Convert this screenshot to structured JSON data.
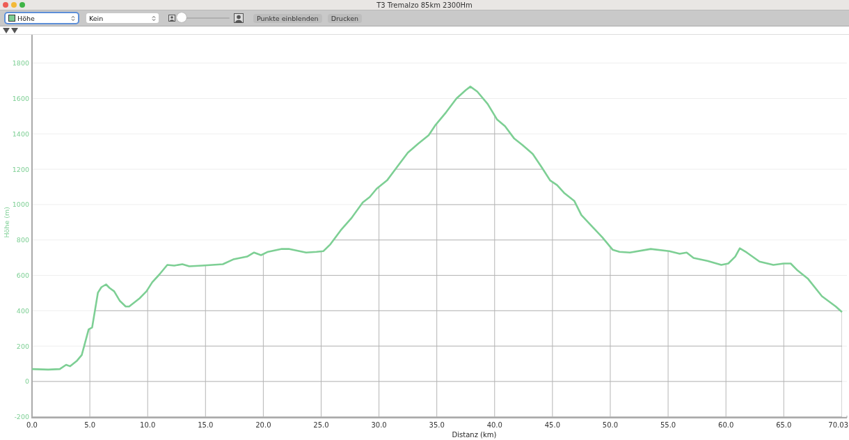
{
  "window": {
    "title": "T3 Tremalzo 85km 2300Hm"
  },
  "toolbar": {
    "series_select": {
      "focused": true
    },
    "secondary_select": {
      "value": "Kein"
    },
    "zoom_slider": {
      "level": 0
    },
    "buttons": [
      "Punkte einblenden",
      "Drucken"
    ]
  },
  "chart": {
    "chart_data": {
      "type": "line",
      "grid": true,
      "xlabel": "Distanz (km)",
      "ylabel": "Höhe (m)",
      "x": [
        0,
        1.4,
        2.4,
        2.95,
        3.3,
        3.9,
        4.3,
        4.9,
        5.2,
        5.7,
        6.0,
        6.4,
        6.7,
        7.1,
        7.6,
        8.1,
        8.4,
        9.3,
        9.9,
        10.4,
        11.0,
        11.7,
        12.3,
        13.0,
        13.6,
        14.7,
        16.5,
        17.4,
        18.6,
        19.2,
        19.8,
        20.4,
        21.6,
        22.2,
        23.7,
        24.6,
        25.2,
        25.8,
        26.7,
        27.6,
        28.6,
        29.2,
        29.8,
        30.7,
        31.6,
        32.5,
        33.4,
        34.3,
        34.9,
        35.8,
        36.7,
        37.5,
        37.9,
        38.5,
        39.4,
        40.2,
        40.9,
        41.7,
        42.4,
        43.3,
        44.1,
        44.8,
        45.4,
        46.0,
        46.9,
        47.5,
        48.4,
        49.3,
        50.2,
        50.8,
        51.7,
        53.5,
        55.1,
        56.0,
        56.6,
        57.2,
        58.4,
        59.6,
        60.2,
        60.8,
        61.2,
        61.8,
        62.9,
        64.1,
        65.0,
        65.6,
        66.2,
        67.1,
        68.3,
        69.5,
        70.03
      ],
      "series": [
        {
          "name": "Höhe",
          "color": "#7dcf94",
          "values": [
            70,
            67,
            70,
            94,
            86,
            118,
            150,
            294,
            305,
            502,
            533,
            549,
            529,
            510,
            455,
            424,
            424,
            470,
            510,
            561,
            604,
            659,
            655,
            663,
            651,
            655,
            663,
            690,
            706,
            729,
            714,
            733,
            749,
            749,
            729,
            733,
            737,
            776,
            855,
            922,
            1012,
            1043,
            1090,
            1137,
            1216,
            1294,
            1345,
            1392,
            1451,
            1522,
            1600,
            1647,
            1667,
            1639,
            1569,
            1482,
            1443,
            1373,
            1337,
            1286,
            1208,
            1137,
            1110,
            1067,
            1020,
            941,
            878,
            816,
            745,
            733,
            729,
            749,
            737,
            722,
            729,
            698,
            682,
            659,
            667,
            706,
            753,
            729,
            678,
            659,
            667,
            667,
            627,
            580,
            482,
            424,
            392
          ]
        }
      ],
      "xlim": [
        0,
        70.46
      ],
      "ylim": [
        -205,
        1960
      ],
      "xticks": [
        {
          "value": 0,
          "label": "0.0"
        },
        {
          "value": 5,
          "label": "5.0"
        },
        {
          "value": 10,
          "label": "10.0"
        },
        {
          "value": 15,
          "label": "15.0"
        },
        {
          "value": 20,
          "label": "20.0"
        },
        {
          "value": 25,
          "label": "25.0"
        },
        {
          "value": 30,
          "label": "30.0"
        },
        {
          "value": 35,
          "label": "35.0"
        },
        {
          "value": 40,
          "label": "40.0"
        },
        {
          "value": 45,
          "label": "45.0"
        },
        {
          "value": 50,
          "label": "50.0"
        },
        {
          "value": 55,
          "label": "55.0"
        },
        {
          "value": 60,
          "label": "60.0"
        },
        {
          "value": 65,
          "label": "65.0"
        },
        {
          "value": 70.03,
          "label": "70.03"
        }
      ],
      "yticks": [
        -200,
        0,
        200,
        400,
        600,
        800,
        1000,
        1200,
        1400,
        1600,
        1800
      ]
    }
  }
}
